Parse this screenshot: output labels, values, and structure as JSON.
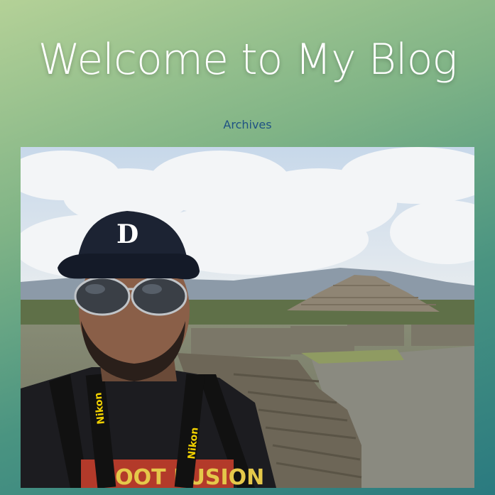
{
  "header": {
    "title": "Welcome to My Blog"
  },
  "nav": {
    "archives_label": "Archives"
  },
  "post": {
    "image_label": "selfie-at-teotihuacan",
    "cap_logo_text": "D",
    "strap_text": "Nikon",
    "shirt_text": "ROOT FUSION"
  },
  "colors": {
    "link": "#1f5283",
    "title": "#ffffff"
  }
}
